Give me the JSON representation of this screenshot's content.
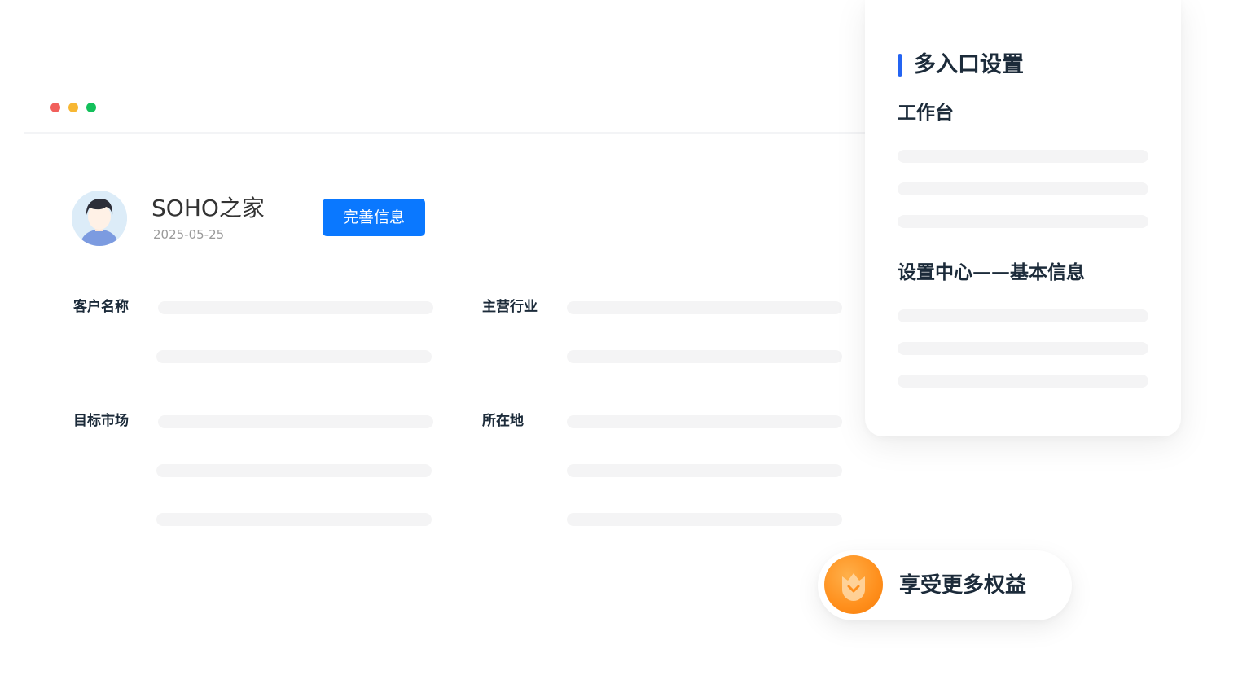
{
  "window": {
    "controls": [
      {
        "name": "close",
        "color": "#f15f5b"
      },
      {
        "name": "minimize",
        "color": "#f7b733"
      },
      {
        "name": "maximize",
        "color": "#13c05b"
      }
    ]
  },
  "profile": {
    "avatar_icon": "user-avatar-icon",
    "company_name": "SOHO之家",
    "date": "2025-05-25",
    "complete_button_label": "完善信息",
    "accent_color": "#0a78ff"
  },
  "form": {
    "fields": [
      {
        "label": "客户名称"
      },
      {
        "label": "主营行业"
      },
      {
        "label": "目标市场"
      },
      {
        "label": "所在地"
      }
    ]
  },
  "settings_panel": {
    "title": "多入口设置",
    "accent_color": "#2464f2",
    "sections": [
      {
        "title": "工作台"
      },
      {
        "title": "设置中心——基本信息"
      }
    ]
  },
  "benefit": {
    "icon": "crown-badge-icon",
    "label": "享受更多权益",
    "icon_color": "#ff8f1c"
  }
}
